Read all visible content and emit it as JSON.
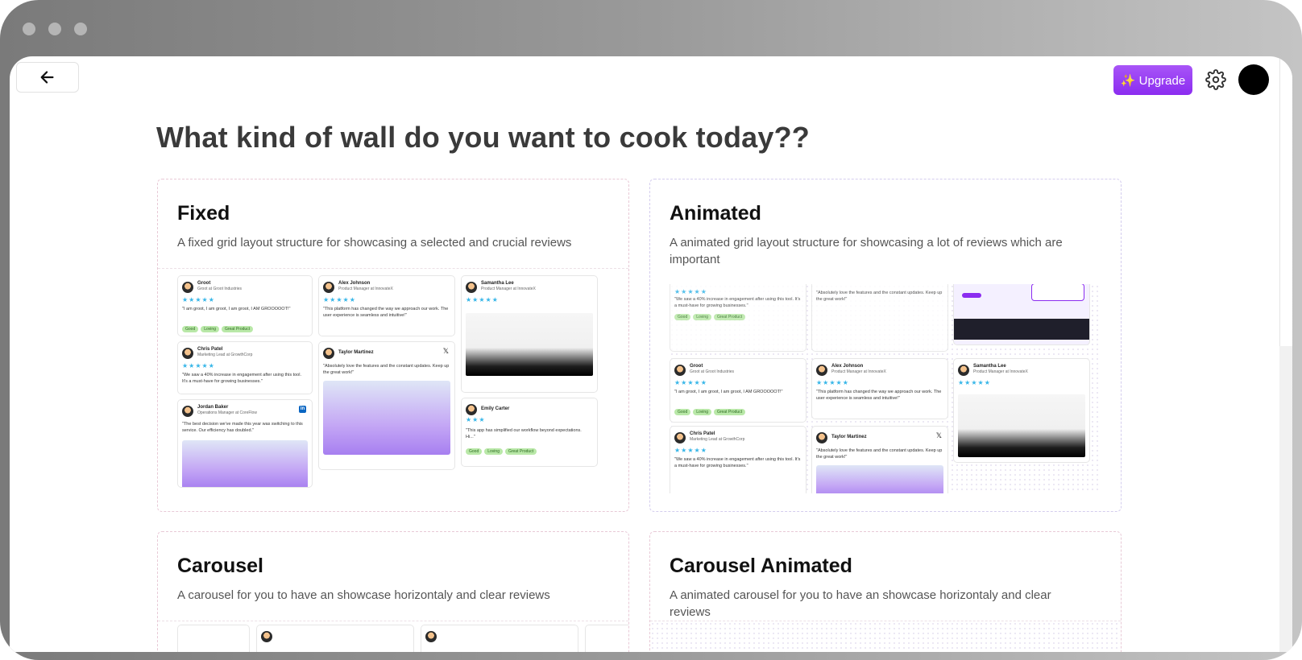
{
  "header": {
    "upgrade_label": "✨ Upgrade",
    "icons": [
      "arrow-left-icon",
      "gear-icon"
    ]
  },
  "page": {
    "title": "What kind of wall do you want to cook today??"
  },
  "cards": [
    {
      "title": "Fixed",
      "description": "A fixed grid layout structure for showcasing a selected and crucial reviews"
    },
    {
      "title": "Animated",
      "description": "A animated grid layout structure for showcasing a lot of reviews which are important"
    },
    {
      "title": "Carousel",
      "description": "A carousel for you to have an showcase horizontaly and clear reviews"
    },
    {
      "title": "Carousel Animated",
      "description": "A animated carousel for you to have an showcase horizontaly and clear reviews"
    }
  ],
  "preview_reviews": {
    "groot": {
      "name": "Groot",
      "role": "Groot at Groot Industries",
      "text": "\"I am groot, I am groot, I am groot, I AM GROOOOOT!\""
    },
    "alex": {
      "name": "Alex Johnson",
      "role": "Product Manager at InnovateX",
      "text": "\"This platform has changed the way we approach our work. The user experience is seamless and intuitive!\""
    },
    "samantha": {
      "name": "Samantha Lee",
      "role": "Product Manager at InnovateX"
    },
    "chris": {
      "name": "Chris Patel",
      "role": "Marketing Lead at GrowthCorp",
      "text": "\"We saw a 40% increase in engagement after using this tool. It's a must-have for growing businesses.\""
    },
    "taylor": {
      "name": "Taylor Martinez",
      "text": "\"Absolutely love the features and the constant updates. Keep up the great work!\""
    },
    "jordan": {
      "name": "Jordan Baker",
      "role": "Operations Manager at CoreFlow",
      "text": "\"The best decision we've made this year was switching to this service. Our efficiency has doubled.\""
    },
    "emily": {
      "name": "Emily Carter",
      "text": "\"This app has simplified our workflow beyond expectations. Hi...\""
    },
    "tags": [
      "Good",
      "Loving",
      "Great Product"
    ],
    "stars": "★★★★★",
    "stars3": "★★★"
  }
}
